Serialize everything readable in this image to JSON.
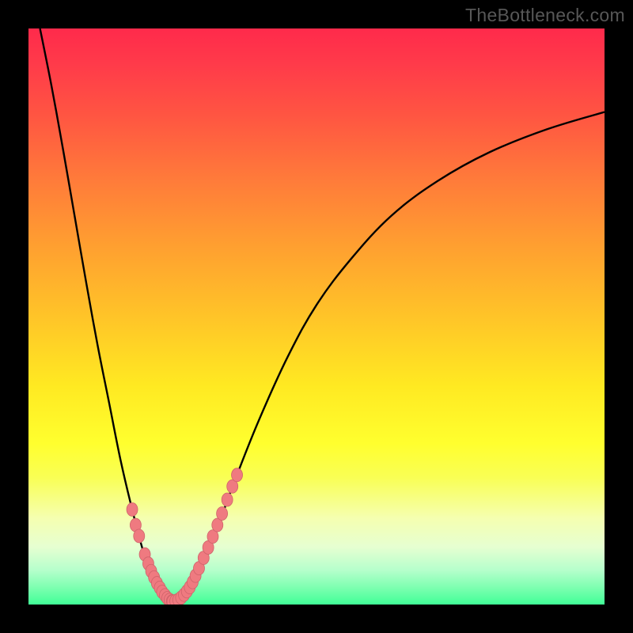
{
  "watermark": "TheBottleneck.com",
  "colors": {
    "curve": "#000000",
    "beads": "#ef7a80",
    "beadStroke": "#cf636a"
  },
  "chart_data": {
    "type": "line",
    "title": "",
    "xlabel": "",
    "ylabel": "",
    "xlim": [
      0,
      100
    ],
    "ylim": [
      0,
      100
    ],
    "grid": false,
    "legend": false,
    "series": [
      {
        "name": "left-branch",
        "x": [
          2,
          4,
          6,
          8,
          10,
          12,
          14,
          16,
          18,
          20,
          22,
          23.5,
          25
        ],
        "y": [
          100,
          90,
          79,
          67.5,
          56,
          45,
          35,
          25,
          16.5,
          9,
          4,
          1.5,
          0.5
        ]
      },
      {
        "name": "right-branch",
        "x": [
          25,
          26.5,
          28,
          30,
          33,
          36,
          40,
          45,
          50,
          56,
          63,
          71,
          80,
          90,
          100
        ],
        "y": [
          0.5,
          1.2,
          3,
          7,
          14,
          22,
          32,
          43,
          52,
          60,
          67.5,
          73.5,
          78.5,
          82.5,
          85.5
        ]
      }
    ],
    "annotations": [
      {
        "name": "left-beads",
        "x": [
          18.0,
          18.6,
          19.2,
          20.2,
          20.8,
          21.3,
          21.8,
          22.3,
          22.8,
          23.2,
          23.7,
          24.1,
          24.5,
          24.9
        ],
        "y": [
          16.5,
          13.8,
          11.9,
          8.7,
          7.1,
          5.8,
          4.7,
          3.7,
          2.9,
          2.2,
          1.6,
          1.1,
          0.8,
          0.55
        ]
      },
      {
        "name": "bottom-beads",
        "x": [
          25.0,
          25.5,
          26.0,
          26.5,
          27.0,
          27.5,
          28.0
        ],
        "y": [
          0.5,
          0.6,
          0.8,
          1.2,
          1.7,
          2.3,
          3.0
        ]
      },
      {
        "name": "right-beads",
        "x": [
          28.5,
          29.0,
          29.6,
          30.4,
          31.2,
          32.0,
          32.8,
          33.6,
          34.5,
          35.4,
          36.2
        ],
        "y": [
          3.9,
          5.0,
          6.3,
          8.1,
          9.9,
          11.8,
          13.8,
          15.8,
          18.2,
          20.5,
          22.5
        ]
      }
    ]
  }
}
